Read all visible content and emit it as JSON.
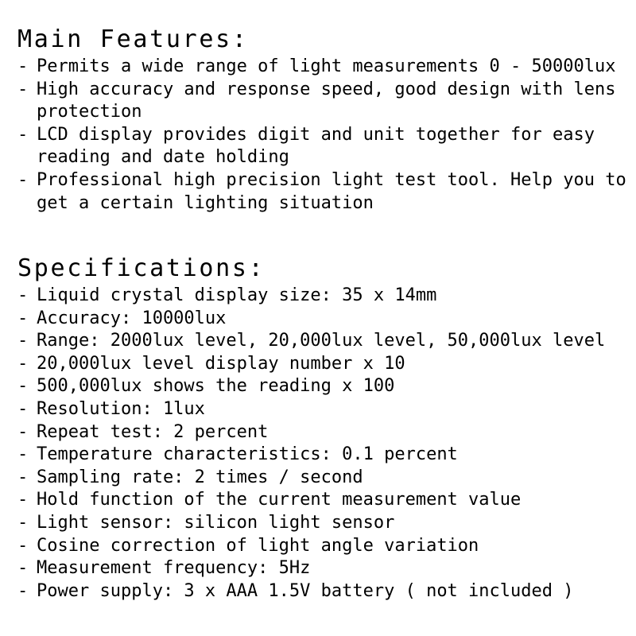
{
  "document": {
    "background_color": "#ffffff",
    "text_color": "#000000",
    "bullet_marker": "-"
  },
  "features": {
    "heading": "Main Features:",
    "items": [
      "Permits a wide range of light measurements 0 - 50000lux",
      "High accuracy and response speed, good design with lens protection",
      "LCD display provides digit and unit together for easy reading and date holding",
      "Professional high precision light test tool. Help you to get a certain lighting situation"
    ]
  },
  "specifications": {
    "heading": "Specifications:",
    "items": [
      "Liquid crystal display size: 35 x 14mm",
      "Accuracy: 10000lux",
      "Range: 2000lux level, 20,000lux level, 50,000lux level",
      "20,000lux level display number x 10",
      "500,000lux shows the reading x 100",
      "Resolution: 1lux",
      "Repeat test: 2 percent",
      "Temperature characteristics: 0.1 percent",
      "Sampling rate: 2 times / second",
      "Hold function of the current measurement value",
      "Light sensor: silicon light sensor",
      "Cosine correction of light angle variation",
      "Measurement frequency: 5Hz",
      "Power supply: 3 x AAA 1.5V battery ( not included )"
    ]
  }
}
